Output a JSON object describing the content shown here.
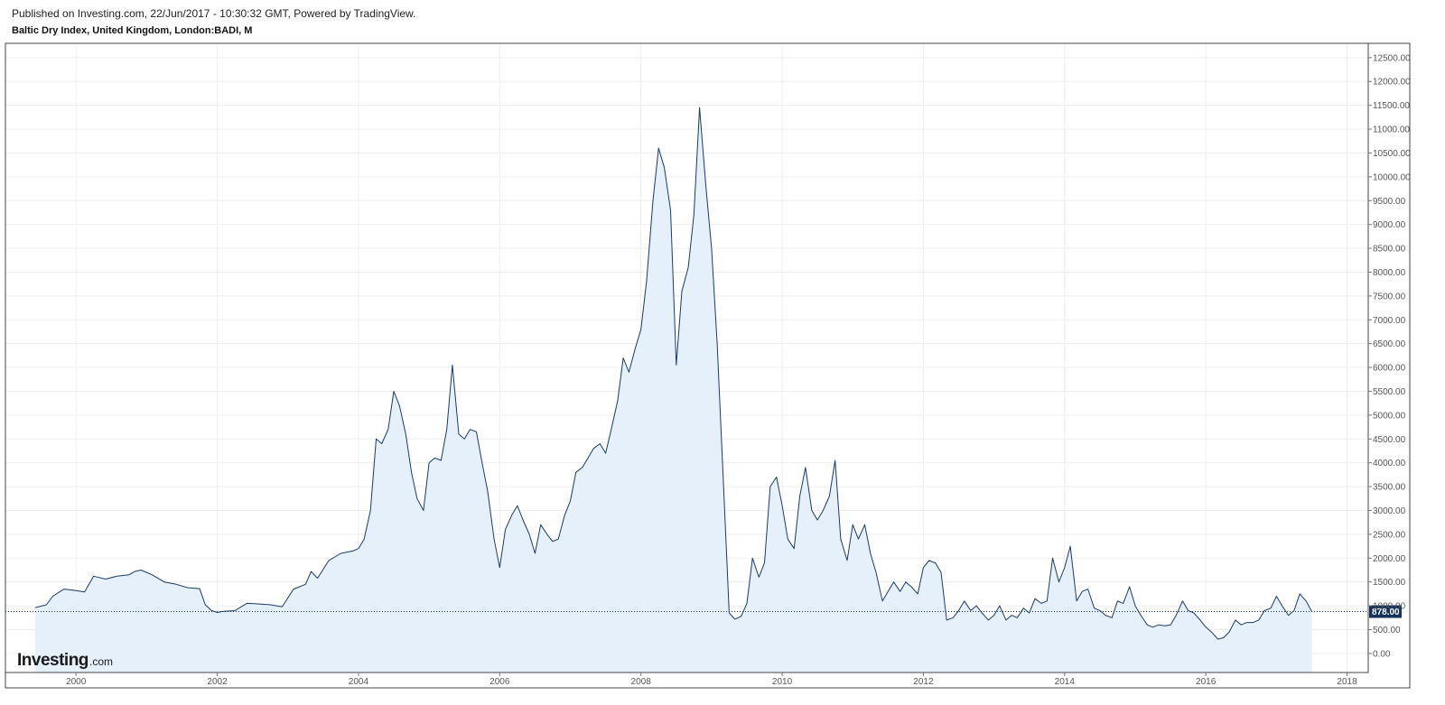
{
  "header": {
    "published": "Published on Investing.com, 22/Jun/2017 - 10:30:32 GMT, Powered by TradingView.",
    "title": "Baltic Dry Index, United Kingdom, London:BADI, M"
  },
  "logo": {
    "main": "Investing",
    "sub": ".com"
  },
  "colors": {
    "line": "#1b3a66",
    "fill": "#e6f0fb",
    "grid": "#eeeeee",
    "frame": "#444444",
    "last_badge": "#13325c"
  },
  "chart_data": {
    "type": "area",
    "title": "Baltic Dry Index, United Kingdom, London:BADI, M",
    "xlabel": "",
    "ylabel": "",
    "xlim": [
      1999.0,
      2018.3
    ],
    "ylim": [
      -400,
      12800
    ],
    "x_ticks": [
      2000,
      2002,
      2004,
      2006,
      2008,
      2010,
      2012,
      2014,
      2016,
      2018
    ],
    "x_tick_labels": [
      "2000",
      "2002",
      "2004",
      "2006",
      "2008",
      "2010",
      "2012",
      "2014",
      "2016",
      "2018"
    ],
    "y_ticks": [
      0,
      500,
      1000,
      1500,
      2000,
      2500,
      3000,
      3500,
      4000,
      4500,
      5000,
      5500,
      6000,
      6500,
      7000,
      7500,
      8000,
      8500,
      9000,
      9500,
      10000,
      10500,
      11000,
      11500,
      12000,
      12500
    ],
    "y_tick_labels": [
      "0.00",
      "500.00",
      "1000.00",
      "1500.00",
      "2000.00",
      "2500.00",
      "3000.00",
      "3500.00",
      "4000.00",
      "4500.00",
      "5000.00",
      "5500.00",
      "6000.00",
      "6500.00",
      "7000.00",
      "7500.00",
      "8000.00",
      "8500.00",
      "9000.00",
      "9500.00",
      "10000.00",
      "10500.00",
      "11000.00",
      "11500.00",
      "12000.00",
      "12500.00"
    ],
    "grid": true,
    "last_value": 878,
    "last_value_label": "878.00",
    "series": [
      {
        "points": [
          [
            1999.42,
            960
          ],
          [
            1999.58,
            1020
          ],
          [
            1999.67,
            1200
          ],
          [
            1999.83,
            1350
          ],
          [
            2000.0,
            1320
          ],
          [
            2000.12,
            1290
          ],
          [
            2000.25,
            1620
          ],
          [
            2000.42,
            1560
          ],
          [
            2000.58,
            1620
          ],
          [
            2000.75,
            1650
          ],
          [
            2000.83,
            1720
          ],
          [
            2000.92,
            1750
          ],
          [
            2001.08,
            1650
          ],
          [
            2001.25,
            1500
          ],
          [
            2001.42,
            1450
          ],
          [
            2001.58,
            1380
          ],
          [
            2001.75,
            1360
          ],
          [
            2001.83,
            1020
          ],
          [
            2001.92,
            900
          ],
          [
            2002.0,
            860
          ],
          [
            2002.08,
            880
          ],
          [
            2002.25,
            900
          ],
          [
            2002.42,
            1050
          ],
          [
            2002.58,
            1040
          ],
          [
            2002.75,
            1020
          ],
          [
            2002.92,
            980
          ],
          [
            2003.08,
            1350
          ],
          [
            2003.25,
            1450
          ],
          [
            2003.33,
            1720
          ],
          [
            2003.42,
            1580
          ],
          [
            2003.58,
            1950
          ],
          [
            2003.75,
            2100
          ],
          [
            2003.92,
            2150
          ],
          [
            2004.0,
            2200
          ],
          [
            2004.08,
            2400
          ],
          [
            2004.17,
            3000
          ],
          [
            2004.25,
            4500
          ],
          [
            2004.33,
            4400
          ],
          [
            2004.42,
            4700
          ],
          [
            2004.5,
            5500
          ],
          [
            2004.58,
            5200
          ],
          [
            2004.67,
            4600
          ],
          [
            2004.75,
            3800
          ],
          [
            2004.83,
            3250
          ],
          [
            2004.92,
            3000
          ],
          [
            2005.0,
            4000
          ],
          [
            2005.08,
            4100
          ],
          [
            2005.17,
            4050
          ],
          [
            2005.25,
            4700
          ],
          [
            2005.33,
            6050
          ],
          [
            2005.42,
            4600
          ],
          [
            2005.5,
            4500
          ],
          [
            2005.58,
            4700
          ],
          [
            2005.67,
            4650
          ],
          [
            2005.75,
            4000
          ],
          [
            2005.83,
            3400
          ],
          [
            2005.92,
            2400
          ],
          [
            2006.0,
            1800
          ],
          [
            2006.08,
            2600
          ],
          [
            2006.17,
            2900
          ],
          [
            2006.25,
            3100
          ],
          [
            2006.33,
            2800
          ],
          [
            2006.42,
            2500
          ],
          [
            2006.5,
            2100
          ],
          [
            2006.58,
            2700
          ],
          [
            2006.67,
            2500
          ],
          [
            2006.75,
            2350
          ],
          [
            2006.83,
            2400
          ],
          [
            2006.92,
            2900
          ],
          [
            2007.0,
            3200
          ],
          [
            2007.08,
            3800
          ],
          [
            2007.17,
            3900
          ],
          [
            2007.25,
            4100
          ],
          [
            2007.33,
            4300
          ],
          [
            2007.42,
            4400
          ],
          [
            2007.5,
            4200
          ],
          [
            2007.58,
            4700
          ],
          [
            2007.67,
            5300
          ],
          [
            2007.75,
            6200
          ],
          [
            2007.83,
            5900
          ],
          [
            2007.92,
            6400
          ],
          [
            2008.0,
            6800
          ],
          [
            2008.08,
            7800
          ],
          [
            2008.17,
            9500
          ],
          [
            2008.25,
            10600
          ],
          [
            2008.33,
            10200
          ],
          [
            2008.42,
            9300
          ],
          [
            2008.5,
            6050
          ],
          [
            2008.58,
            7600
          ],
          [
            2008.67,
            8100
          ],
          [
            2008.75,
            9200
          ],
          [
            2008.83,
            11450
          ],
          [
            2008.92,
            9800
          ],
          [
            2009.0,
            8500
          ],
          [
            2009.08,
            6500
          ],
          [
            2009.17,
            3500
          ],
          [
            2009.25,
            850
          ],
          [
            2009.33,
            720
          ],
          [
            2009.42,
            780
          ],
          [
            2009.5,
            1050
          ],
          [
            2009.58,
            2000
          ],
          [
            2009.67,
            1600
          ],
          [
            2009.75,
            1900
          ],
          [
            2009.83,
            3500
          ],
          [
            2009.92,
            3700
          ],
          [
            2010.0,
            3100
          ],
          [
            2010.08,
            2400
          ],
          [
            2010.17,
            2200
          ],
          [
            2010.25,
            3300
          ],
          [
            2010.33,
            3900
          ],
          [
            2010.42,
            3000
          ],
          [
            2010.5,
            2800
          ],
          [
            2010.58,
            3000
          ],
          [
            2010.67,
            3300
          ],
          [
            2010.75,
            4050
          ],
          [
            2010.83,
            2400
          ],
          [
            2010.92,
            1950
          ],
          [
            2011.0,
            2700
          ],
          [
            2011.08,
            2400
          ],
          [
            2011.17,
            2700
          ],
          [
            2011.25,
            2100
          ],
          [
            2011.33,
            1700
          ],
          [
            2011.42,
            1100
          ],
          [
            2011.5,
            1300
          ],
          [
            2011.58,
            1500
          ],
          [
            2011.67,
            1300
          ],
          [
            2011.75,
            1500
          ],
          [
            2011.83,
            1400
          ],
          [
            2011.92,
            1250
          ],
          [
            2012.0,
            1800
          ],
          [
            2012.08,
            1950
          ],
          [
            2012.17,
            1900
          ],
          [
            2012.25,
            1700
          ],
          [
            2012.33,
            700
          ],
          [
            2012.42,
            750
          ],
          [
            2012.5,
            900
          ],
          [
            2012.58,
            1100
          ],
          [
            2012.67,
            900
          ],
          [
            2012.75,
            1000
          ],
          [
            2012.83,
            850
          ],
          [
            2012.92,
            700
          ],
          [
            2013.0,
            800
          ],
          [
            2013.08,
            1000
          ],
          [
            2013.17,
            700
          ],
          [
            2013.25,
            800
          ],
          [
            2013.33,
            750
          ],
          [
            2013.42,
            950
          ],
          [
            2013.5,
            850
          ],
          [
            2013.58,
            1150
          ],
          [
            2013.67,
            1050
          ],
          [
            2013.75,
            1100
          ],
          [
            2013.83,
            2000
          ],
          [
            2013.92,
            1500
          ],
          [
            2014.0,
            1800
          ],
          [
            2014.08,
            2250
          ],
          [
            2014.17,
            1100
          ],
          [
            2014.25,
            1300
          ],
          [
            2014.33,
            1350
          ],
          [
            2014.42,
            950
          ],
          [
            2014.5,
            900
          ],
          [
            2014.58,
            800
          ],
          [
            2014.67,
            750
          ],
          [
            2014.75,
            1100
          ],
          [
            2014.83,
            1050
          ],
          [
            2014.92,
            1400
          ],
          [
            2015.0,
            1000
          ],
          [
            2015.08,
            800
          ],
          [
            2015.17,
            600
          ],
          [
            2015.25,
            550
          ],
          [
            2015.33,
            600
          ],
          [
            2015.42,
            580
          ],
          [
            2015.5,
            600
          ],
          [
            2015.58,
            800
          ],
          [
            2015.67,
            1100
          ],
          [
            2015.75,
            900
          ],
          [
            2015.83,
            850
          ],
          [
            2015.92,
            700
          ],
          [
            2016.0,
            550
          ],
          [
            2016.08,
            450
          ],
          [
            2016.17,
            300
          ],
          [
            2016.25,
            330
          ],
          [
            2016.33,
            450
          ],
          [
            2016.42,
            700
          ],
          [
            2016.5,
            600
          ],
          [
            2016.58,
            650
          ],
          [
            2016.67,
            650
          ],
          [
            2016.75,
            700
          ],
          [
            2016.83,
            900
          ],
          [
            2016.92,
            950
          ],
          [
            2017.0,
            1200
          ],
          [
            2017.08,
            1000
          ],
          [
            2017.17,
            800
          ],
          [
            2017.25,
            900
          ],
          [
            2017.33,
            1250
          ],
          [
            2017.42,
            1100
          ],
          [
            2017.5,
            878
          ]
        ]
      }
    ]
  }
}
